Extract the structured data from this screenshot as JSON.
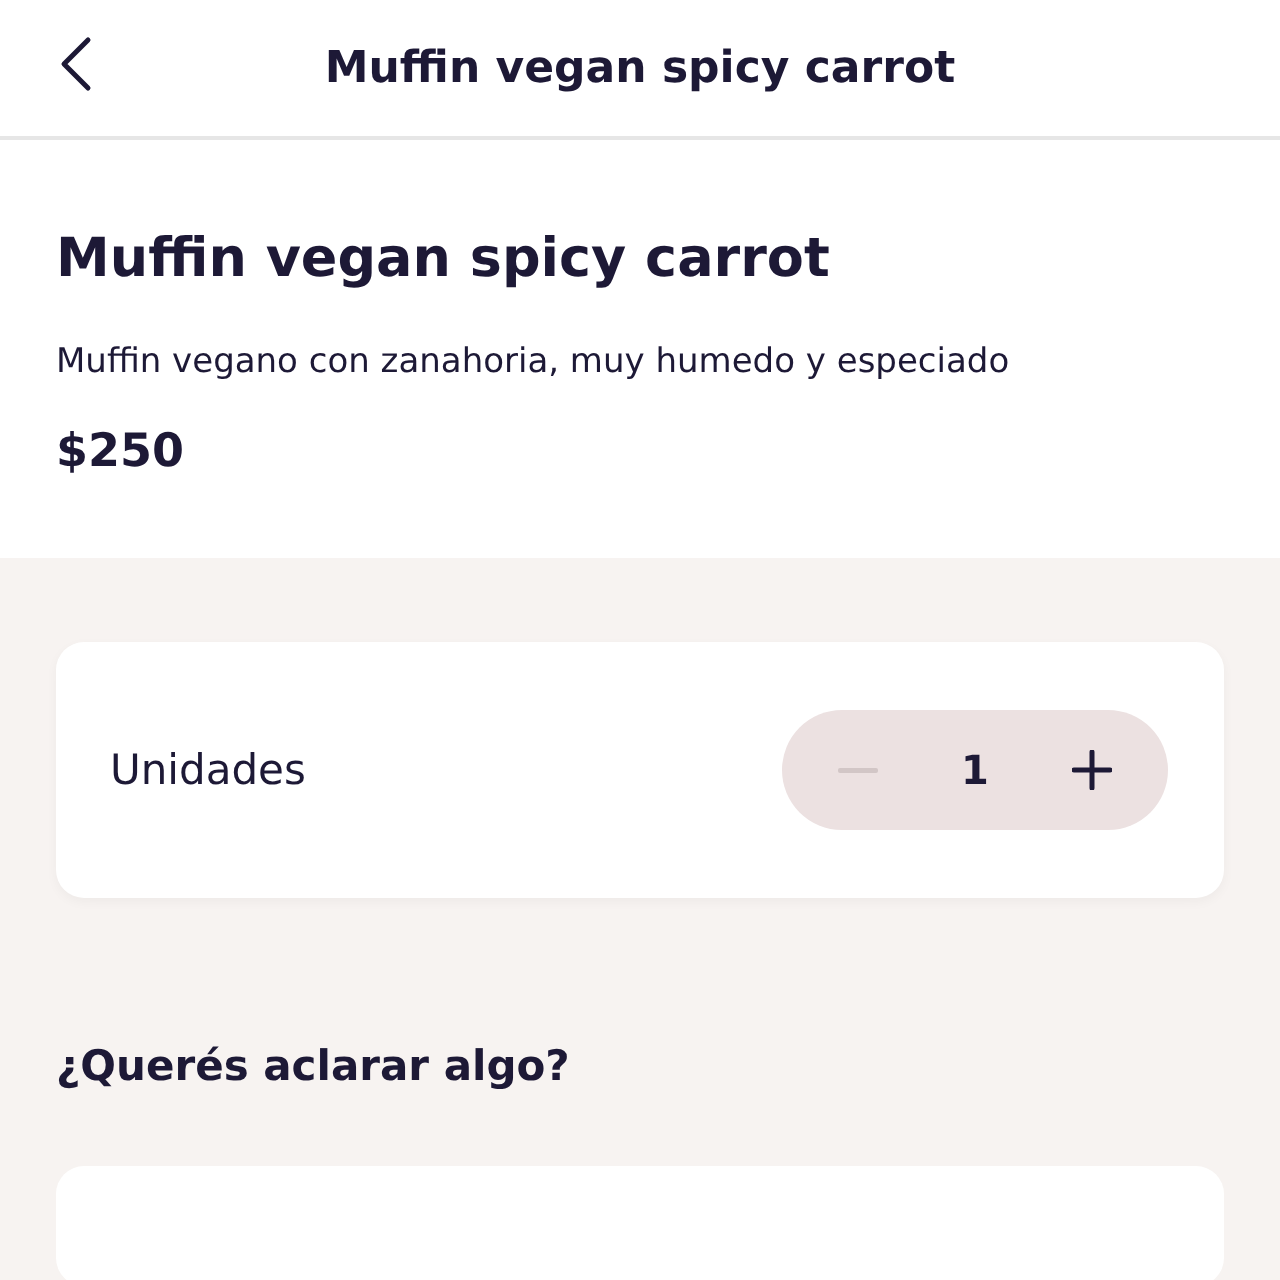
{
  "header": {
    "title": "Muffin vegan spicy carrot"
  },
  "product": {
    "name": "Muffin vegan spicy carrot",
    "description": "Muffin vegano con zanahoria, muy humedo y especiado",
    "price": "$250"
  },
  "quantity": {
    "label": "Unidades",
    "value": "1",
    "decrement_disabled": true,
    "increment_disabled": false
  },
  "notes": {
    "heading": "¿Querés aclarar algo?"
  }
}
